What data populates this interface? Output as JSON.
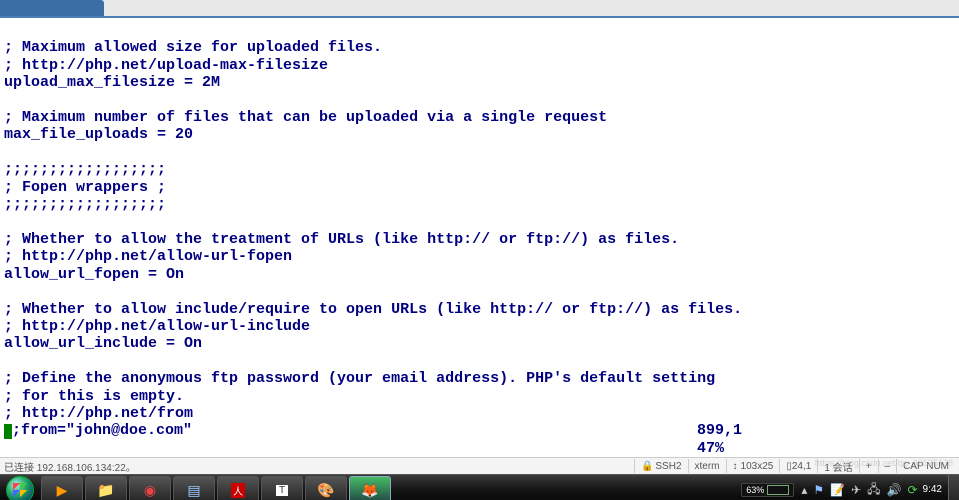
{
  "editor": {
    "lines": [
      "; Maximum allowed size for uploaded files.",
      "; http://php.net/upload-max-filesize",
      "upload_max_filesize = 2M",
      "",
      "; Maximum number of files that can be uploaded via a single request",
      "max_file_uploads = 20",
      "",
      ";;;;;;;;;;;;;;;;;;",
      "; Fopen wrappers ;",
      ";;;;;;;;;;;;;;;;;;",
      "",
      "; Whether to allow the treatment of URLs (like http:// or ftp://) as files.",
      "; http://php.net/allow-url-fopen",
      "allow_url_fopen = On",
      "",
      "; Whether to allow include/require to open URLs (like http:// or ftp://) as files.",
      "; http://php.net/allow-url-include",
      "allow_url_include = On",
      "",
      "; Define the anonymous ftp password (your email address). PHP's default setting",
      "; for this is empty.",
      "; http://php.net/from"
    ],
    "cursor_line": ";from=\"john@doe.com\"",
    "vim_position": "899,1",
    "vim_percent": "47%"
  },
  "terminal_status": {
    "connection": "已连接 192.168.106.134:22。",
    "ssh": "SSH2",
    "term": "xterm",
    "size": "103x25",
    "rc": "24,1",
    "sessions": "1 会话",
    "caps": "CAP  NUM"
  },
  "taskbar": {
    "battery_percent": "63%",
    "clock": "9:42"
  },
  "watermark": "https://blog.csdn.net/qq_38525138"
}
